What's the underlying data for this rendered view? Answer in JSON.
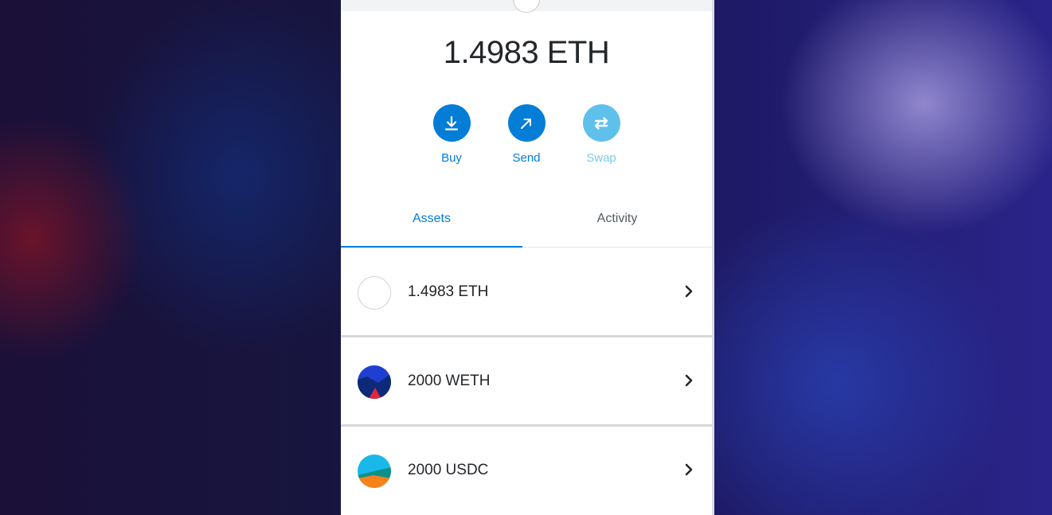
{
  "wallet": {
    "balance": "1.4983 ETH",
    "actions": [
      {
        "label": "Buy",
        "icon": "download-icon",
        "color": "#037dd6",
        "label_color": "#037dd6",
        "enabled": true
      },
      {
        "label": "Send",
        "icon": "arrow-up-right-icon",
        "color": "#037dd6",
        "label_color": "#037dd6",
        "enabled": true
      },
      {
        "label": "Swap",
        "icon": "swap-icon",
        "color": "#5fc0ec",
        "label_color": "#7ccbee",
        "enabled": false
      }
    ],
    "tabs": [
      {
        "label": "Assets",
        "active": true
      },
      {
        "label": "Activity",
        "active": false
      }
    ],
    "assets": [
      {
        "label": "1.4983 ETH",
        "icon": "eth-token-icon"
      },
      {
        "label": "2000 WETH",
        "icon": "weth-token-icon"
      },
      {
        "label": "2000 USDC",
        "icon": "usdc-token-icon"
      }
    ]
  },
  "colors": {
    "accent": "#037dd6",
    "accent_disabled": "#5fc0ec",
    "text": "#24272a",
    "tab_inactive": "#535a61"
  }
}
